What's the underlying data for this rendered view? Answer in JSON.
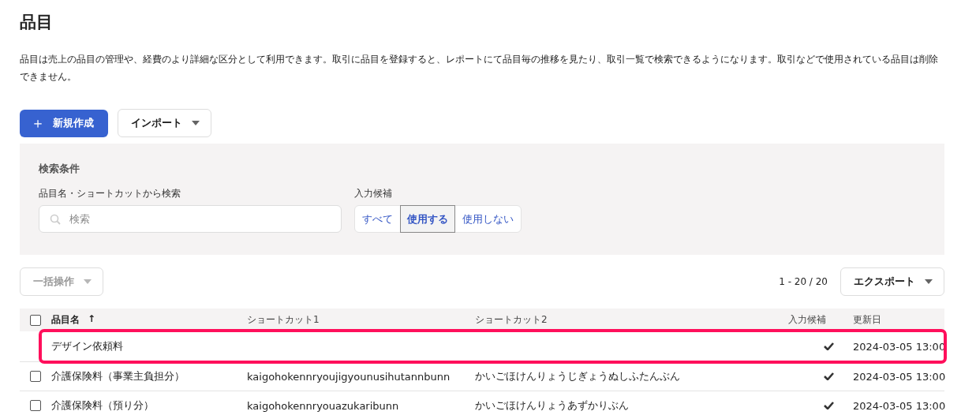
{
  "page": {
    "title": "品目",
    "description": "品目は売上の品目の管理や、経費のより詳細な区分として利用できます。取引に品目を登録すると、レポートにて品目毎の推移を見たり、取引一覧で検索できるようになります。取引などで使用されている品目は削除できません。"
  },
  "actions": {
    "create": {
      "icon": "＋",
      "label": "新規作成"
    },
    "import": {
      "label": "インポート"
    }
  },
  "search_panel": {
    "title": "検索条件",
    "search_label": "品目名・ショートカットから検索",
    "search": {
      "placeholder": "検索"
    },
    "filter_label": "入力候補",
    "filters": [
      {
        "label": "すべて",
        "selected": false
      },
      {
        "label": "使用する",
        "selected": true
      },
      {
        "label": "使用しない",
        "selected": false
      }
    ]
  },
  "bulk_action": {
    "label": "一括操作",
    "disabled": true
  },
  "count": "1 - 20 / 20",
  "export": {
    "label": "エクスポート"
  },
  "table": {
    "header_checked": false,
    "columns": [
      {
        "label": "品目名",
        "sort": "↑"
      },
      {
        "label": "ショートカット1"
      },
      {
        "label": "ショートカット2"
      },
      {
        "label": "入力候補"
      },
      {
        "label": "更新日"
      }
    ],
    "rows": [
      {
        "has_checkbox": false,
        "highlighted": true,
        "name": "デザイン依頼料",
        "suggest": true,
        "updated": "2024-03-05 13:00"
      },
      {
        "has_checkbox": true,
        "checked": false,
        "highlighted": false,
        "name": "介護保険料（事業主負担分）",
        "shortcut1": "kaigohokennryoujigyounusihutannbunn",
        "shortcut2": "かいごほけんりょうじぎょうぬしふたんぶん",
        "suggest": true,
        "updated": "2024-03-05 13:00"
      },
      {
        "has_checkbox": true,
        "checked": false,
        "highlighted": false,
        "name": "介護保険料（預り分）",
        "shortcut1": "kaigohokennryouazukaribunn",
        "shortcut2": "かいごほけんりょうあずかりぶん",
        "suggest": true,
        "updated": "2024-03-05 13:00"
      }
    ]
  }
}
